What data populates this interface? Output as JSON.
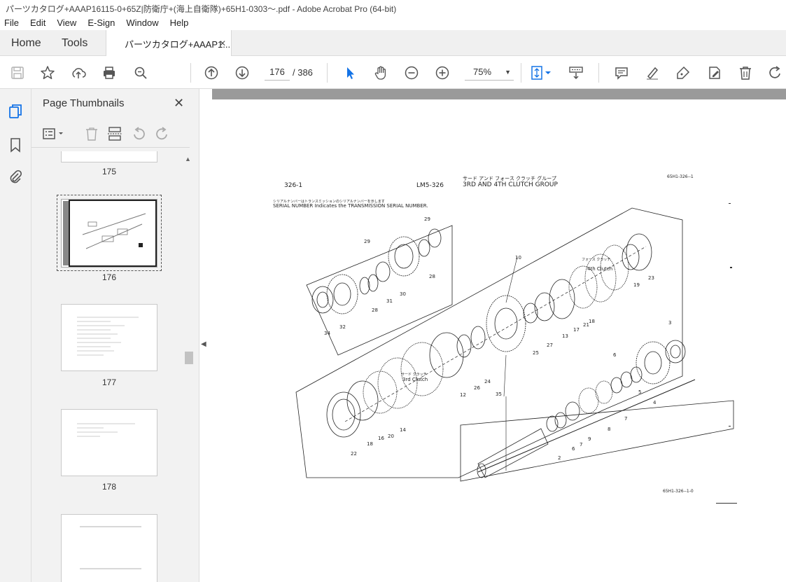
{
  "window": {
    "title": "パーツカタログ+AAAP16115-0+65Z|防衛庁+(海上自衛隊)+65H1-0303〜.pdf - Adobe Acrobat Pro (64-bit)"
  },
  "menu": [
    "File",
    "Edit",
    "View",
    "E-Sign",
    "Window",
    "Help"
  ],
  "tabs": {
    "home": "Home",
    "tools": "Tools",
    "document": "パーツカタログ+AAAP1..."
  },
  "toolbar": {
    "current_page": "176",
    "total_pages": "/ 386",
    "zoom": "75%"
  },
  "thumbnails_panel": {
    "title": "Page Thumbnails",
    "pages": [
      {
        "label": "175"
      },
      {
        "label": "176"
      },
      {
        "label": "177"
      },
      {
        "label": "178"
      }
    ]
  },
  "document": {
    "page_code_left": "326-1",
    "model_code": "LM5-326",
    "title_jp": "サード アンド フォース クラッチ グループ",
    "title_en": "3RD AND 4TH CLUTCH GROUP",
    "ref_top_right": "65H1-326--1",
    "note_jp": "シリアルナンバーはトランスミッションのシリアルナンバーを示します",
    "note_en": "SERIAL NUMBER Indicates the TRANSMISSION SERIAL NUMBER.",
    "label_4th_jp": "フォース クラッチ",
    "label_4th_en": "4th Clutch",
    "label_3rd_jp": "サード クラッチ",
    "label_3rd_en": "3rd Clutch",
    "ref_bottom_right": "65H1-326--1-0",
    "callouts": [
      "29",
      "29",
      "28",
      "28",
      "31",
      "30",
      "32",
      "34",
      "10",
      "19",
      "23",
      "17",
      "18",
      "21",
      "13",
      "27",
      "25",
      "24",
      "26",
      "12",
      "35",
      "3",
      "6",
      "4",
      "5",
      "7",
      "8",
      "9",
      "6",
      "7",
      "2",
      "22",
      "16",
      "18",
      "20",
      "14"
    ]
  }
}
